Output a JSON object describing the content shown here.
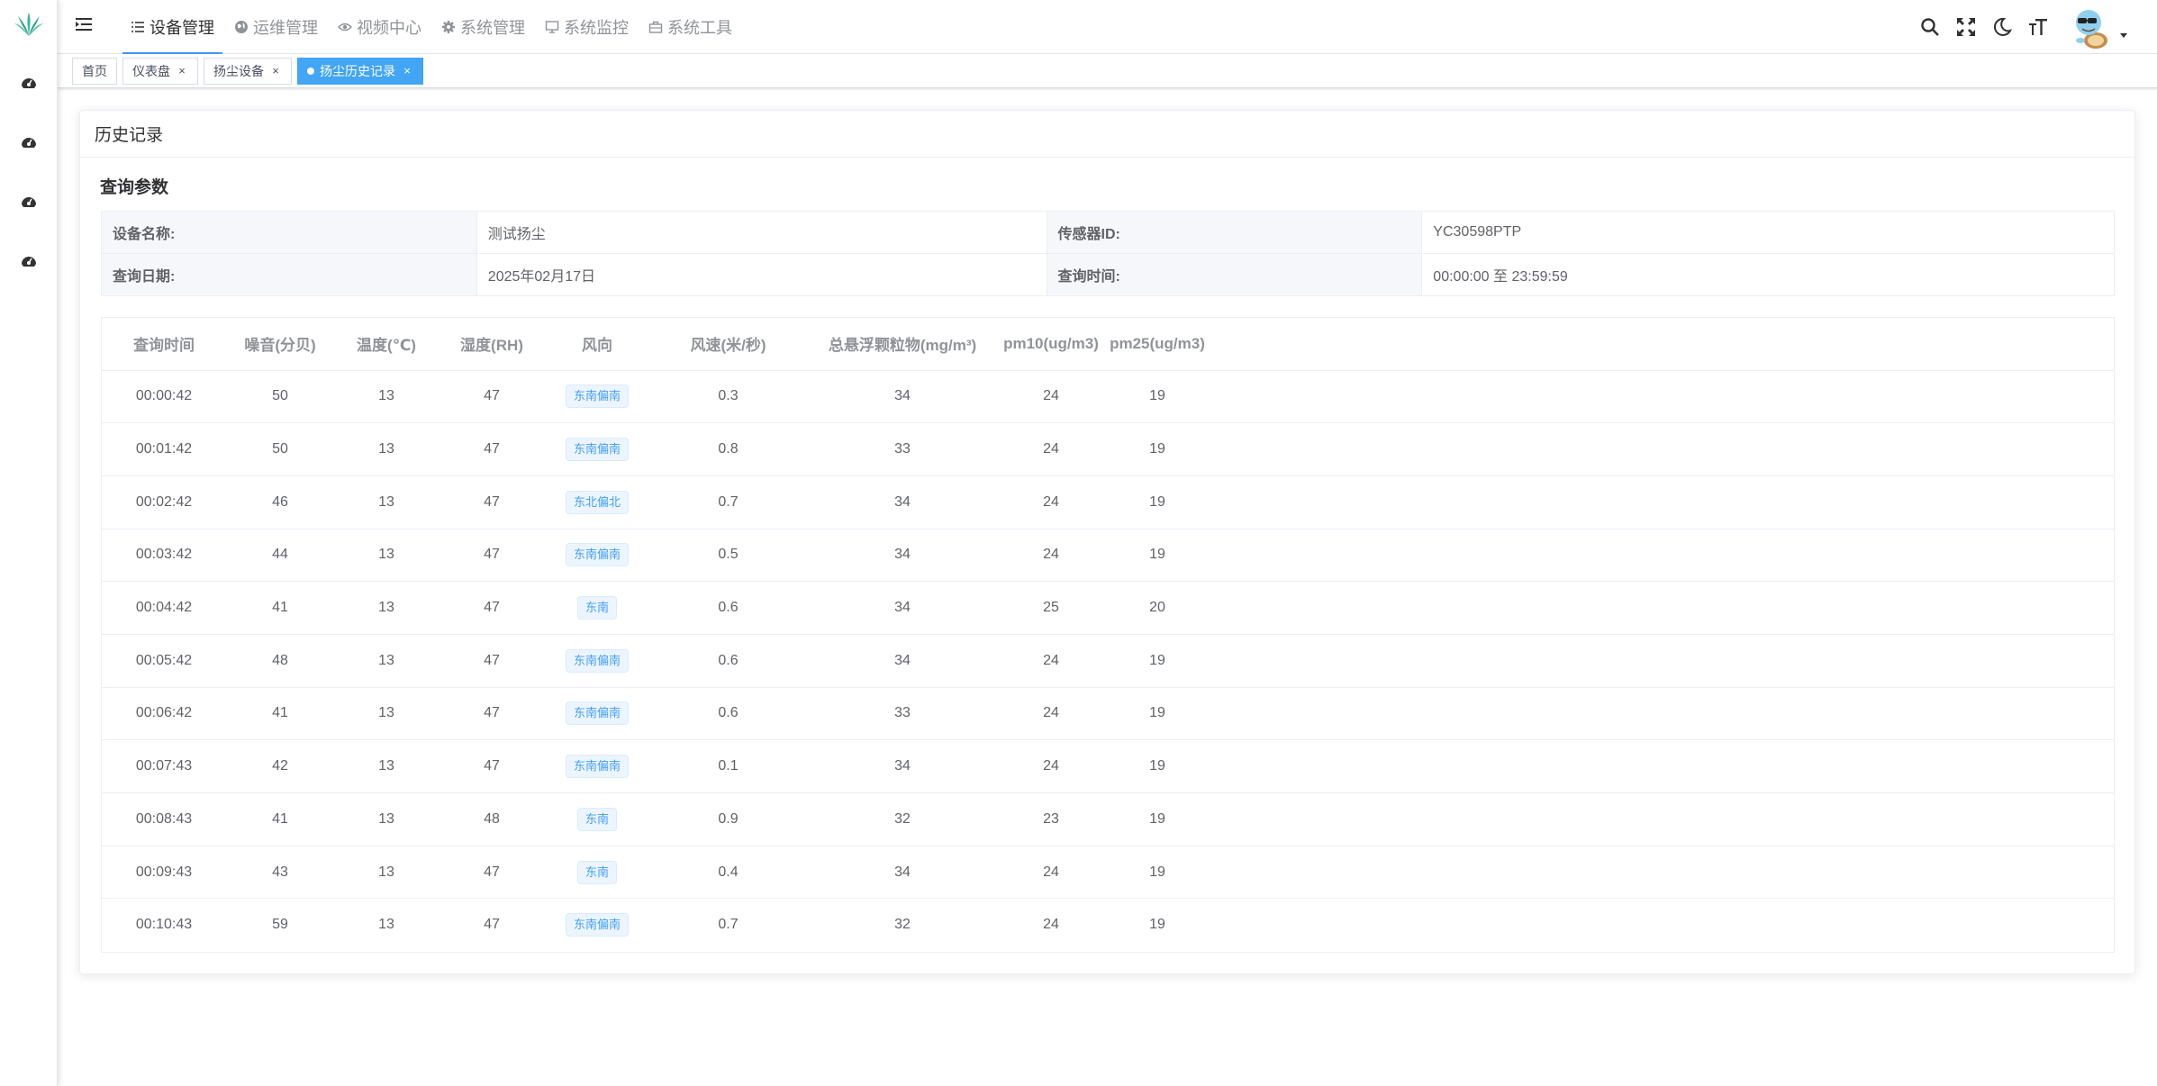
{
  "sidebar": {
    "items": [
      {
        "icon": "dashboard-icon"
      },
      {
        "icon": "dashboard-icon"
      },
      {
        "icon": "dashboard-icon"
      },
      {
        "icon": "dashboard-icon"
      }
    ]
  },
  "navbar": {
    "menu": [
      {
        "label": "设备管理",
        "icon": "list-icon",
        "active": true
      },
      {
        "label": "运维管理",
        "icon": "globe-icon",
        "active": false
      },
      {
        "label": "视频中心",
        "icon": "eye-icon",
        "active": false
      },
      {
        "label": "系统管理",
        "icon": "gear-icon",
        "active": false
      },
      {
        "label": "系统监控",
        "icon": "monitor-icon",
        "active": false
      },
      {
        "label": "系统工具",
        "icon": "toolbox-icon",
        "active": false
      }
    ],
    "tools": [
      "search-icon",
      "fullscreen-icon",
      "moon-icon",
      "font-size-icon"
    ]
  },
  "tags": [
    {
      "label": "首页",
      "closable": false,
      "active": false
    },
    {
      "label": "仪表盘",
      "closable": true,
      "active": false
    },
    {
      "label": "扬尘设备",
      "closable": true,
      "active": false
    },
    {
      "label": "扬尘历史记录",
      "closable": true,
      "active": true
    }
  ],
  "card": {
    "title": "历史记录",
    "section_title": "查询参数"
  },
  "query": {
    "device_name_label": "设备名称:",
    "device_name": "测试扬尘",
    "sensor_id_label": "传感器ID:",
    "sensor_id": "YC30598PTP",
    "date_label": "查询日期:",
    "date": "2025年02月17日",
    "time_label": "查询时间:",
    "time": "00:00:00 至 23:59:59"
  },
  "table": {
    "headers": [
      "查询时间",
      "噪音(分贝)",
      "温度(℃)",
      "湿度(RH)",
      "风向",
      "风速(米/秒)",
      "总悬浮颗粒物(mg/m³)",
      "pm10(ug/m3)",
      "pm25(ug/m3)"
    ],
    "rows": [
      [
        "00:00:42",
        "50",
        "13",
        "47",
        "东南偏南",
        "0.3",
        "34",
        "24",
        "19"
      ],
      [
        "00:01:42",
        "50",
        "13",
        "47",
        "东南偏南",
        "0.8",
        "33",
        "24",
        "19"
      ],
      [
        "00:02:42",
        "46",
        "13",
        "47",
        "东北偏北",
        "0.7",
        "34",
        "24",
        "19"
      ],
      [
        "00:03:42",
        "44",
        "13",
        "47",
        "东南偏南",
        "0.5",
        "34",
        "24",
        "19"
      ],
      [
        "00:04:42",
        "41",
        "13",
        "47",
        "东南",
        "0.6",
        "34",
        "25",
        "20"
      ],
      [
        "00:05:42",
        "48",
        "13",
        "47",
        "东南偏南",
        "0.6",
        "34",
        "24",
        "19"
      ],
      [
        "00:06:42",
        "41",
        "13",
        "47",
        "东南偏南",
        "0.6",
        "33",
        "24",
        "19"
      ],
      [
        "00:07:43",
        "42",
        "13",
        "47",
        "东南偏南",
        "0.1",
        "34",
        "24",
        "19"
      ],
      [
        "00:08:43",
        "41",
        "13",
        "48",
        "东南",
        "0.9",
        "32",
        "23",
        "19"
      ],
      [
        "00:09:43",
        "43",
        "13",
        "47",
        "东南",
        "0.4",
        "34",
        "24",
        "19"
      ],
      [
        "00:10:43",
        "59",
        "13",
        "47",
        "东南偏南",
        "0.7",
        "32",
        "24",
        "19"
      ]
    ]
  },
  "colors": {
    "accent": "#409eff",
    "active_tag": "#42a5f5",
    "logo": "#3cb4a0"
  }
}
